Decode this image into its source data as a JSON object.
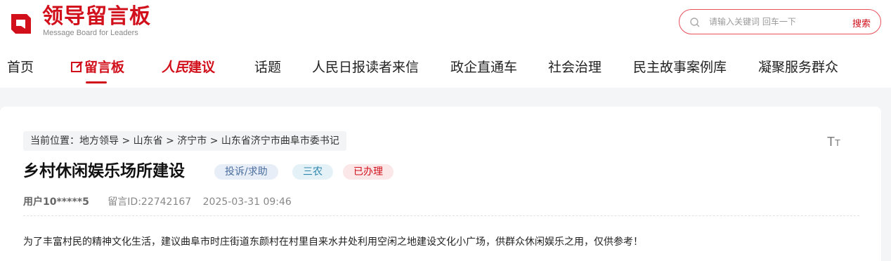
{
  "header": {
    "logo_icon": "message-board-logo-icon",
    "logo_title": "领导留言板",
    "logo_subtitle": "Message Board for Leaders",
    "accent_color": "#d1101b"
  },
  "search": {
    "icon": "search-icon",
    "placeholder": "请输入关键词 回车一下",
    "button_label": "搜索"
  },
  "nav": {
    "items": [
      {
        "label": "首页"
      },
      {
        "label": "留言板",
        "icon": "edit-icon",
        "active": true
      },
      {
        "label": "人民建议",
        "styled_prefix": "人民",
        "suffix": "建议"
      },
      {
        "label": "话题"
      },
      {
        "label": "人民日报读者来信"
      },
      {
        "label": "政企直通车"
      },
      {
        "label": "社会治理"
      },
      {
        "label": "民主故事案例库"
      },
      {
        "label": "凝聚服务群众"
      }
    ]
  },
  "article": {
    "breadcrumb": {
      "prefix": "当前位置：",
      "items": [
        "地方领导",
        "山东省",
        "济宁市",
        "山东省济宁市曲阜市委书记"
      ],
      "separator": ">"
    },
    "font_toggle": "TT",
    "title": "乡村休闲娱乐场所建设",
    "tags": [
      "投诉/求助",
      "三农",
      "已办理"
    ],
    "user": "用户10*****5",
    "message_id": "留言ID:22742167",
    "datetime": "2025-03-31 09:46",
    "content": "为了丰富村民的精神文化生活，建议曲阜市时庄街道东颜村在村里自来水井处利用空闲之地建设文化小广场，供群众休闲娱乐之用，仅供参考！"
  }
}
